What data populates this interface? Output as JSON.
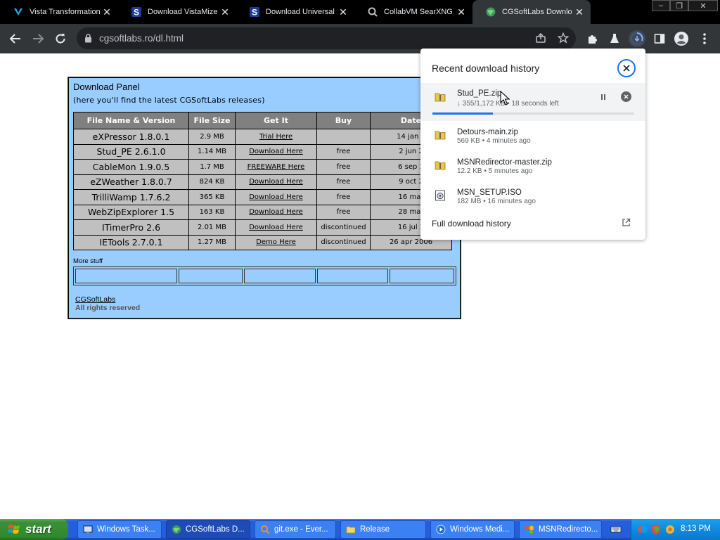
{
  "browser": {
    "tabs": [
      {
        "title": "Vista Transformation",
        "icon": "vista-logo-icon",
        "active": false
      },
      {
        "title": "Download VistaMizer",
        "icon": "s-logo-icon",
        "active": false
      },
      {
        "title": "Download Universal",
        "icon": "s-logo-icon",
        "active": false
      },
      {
        "title": "CollabVM SearXNG",
        "icon": "searxng-icon",
        "active": false
      },
      {
        "title": "CGSoftLabs Downlo",
        "icon": "globe-icon",
        "active": true
      }
    ],
    "url": "cgsoftlabs.ro/dl.html"
  },
  "page": {
    "panel_title": "Download Panel",
    "panel_subtitle": "(here you'll find the latest CGSoftLabs releases)",
    "table": {
      "headers": [
        "File Name & Version",
        "File Size",
        "Get It",
        "Buy",
        "Date"
      ],
      "rows": [
        [
          "eXPressor 1.8.0.1",
          "2.9 MB",
          "Trial Here",
          "",
          "14 jan 2"
        ],
        [
          "Stud_PE 2.6.1.0",
          "1.14 MB",
          "Download Here",
          "free",
          "2 jun 2"
        ],
        [
          "CableMon 1.9.0.5",
          "1.7 MB",
          "FREEWARE Here",
          "free",
          "6 sep 2"
        ],
        [
          "eZWeather 1.8.0.7",
          "824 KB",
          "Download Here",
          "free",
          "9 oct 2"
        ],
        [
          "TrilliWamp 1.7.6.2",
          "365 KB",
          "Download Here",
          "free",
          "16 mar"
        ],
        [
          "WebZipExplorer 1.5",
          "163 KB",
          "Download Here",
          "free",
          "28 mar"
        ],
        [
          "ITimerPro 2.6",
          "2.01 MB",
          "Download Here",
          "discontinued",
          "16 jul 2"
        ],
        [
          "IETools 2.7.0.1",
          "1.27 MB",
          "Demo Here",
          "discontinued",
          "26 apr 2006"
        ]
      ]
    },
    "more_stuff": "More stuff",
    "footer_link": "CGSoftLabs",
    "footer_rights": "All rights reserved"
  },
  "downloads": {
    "header": "Recent download history",
    "items": [
      {
        "name": "Stud_PE.zip",
        "status": "↓ 355/1,172 KB • 18 seconds left",
        "progress": 0.3,
        "in_progress": true
      },
      {
        "name": "Detours-main.zip",
        "status": "569 KB • 4 minutes ago"
      },
      {
        "name": "MSNRedirector-master.zip",
        "status": "12.2 KB • 5 minutes ago"
      },
      {
        "name": "MSN_SETUP.ISO",
        "status": "182 MB • 16 minutes ago"
      }
    ],
    "full_history": "Full download history"
  },
  "taskbar": {
    "start": "start",
    "tasks": [
      {
        "label": "Windows Task...",
        "active": false
      },
      {
        "label": "CGSoftLabs D...",
        "active": true
      },
      {
        "label": "git.exe - Ever...",
        "active": false
      },
      {
        "label": "Release",
        "active": false
      },
      {
        "label": "Windows Medi...",
        "active": false
      },
      {
        "label": "MSNRedirecto...",
        "active": false
      }
    ],
    "clock": "8:13 PM"
  }
}
